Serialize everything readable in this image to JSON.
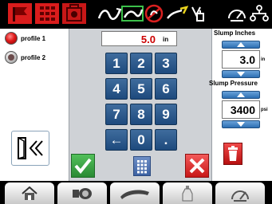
{
  "profiles": [
    {
      "label": "profile 1",
      "selected": true
    },
    {
      "label": "profile 2",
      "selected": false
    }
  ],
  "entry": {
    "value": "5.0",
    "unit": "in"
  },
  "keypad": {
    "rows": [
      [
        "1",
        "2",
        "3"
      ],
      [
        "4",
        "5",
        "6"
      ],
      [
        "7",
        "8",
        "9"
      ]
    ],
    "backspace": "←",
    "zero": "0",
    "decimal": "."
  },
  "slump_inches": {
    "label": "Slump Inches",
    "value": "3.0",
    "unit": "in"
  },
  "slump_pressure": {
    "label": "Slump Pressure",
    "value": "3400",
    "unit": "psi"
  },
  "top_icons": [
    "flag-icon",
    "grid-icon",
    "mixer-icon",
    "drum-rotation-icon",
    "water-flow-icon",
    "no-water-icon",
    "fluid-flow-icon",
    "valve-icon",
    "slump-meter-icon",
    "network-icon"
  ],
  "nav_tabs": [
    "home-icon",
    "drum-icon",
    "ribbon-icon",
    "bottle-icon",
    "gauge-icon"
  ],
  "colors": {
    "topbar": "#000000",
    "panel": "#cfd2d6",
    "key": "#2b5a8c",
    "value_red": "#cc0000",
    "ok_green": "#2a8a34",
    "cancel_red": "#c81717"
  }
}
